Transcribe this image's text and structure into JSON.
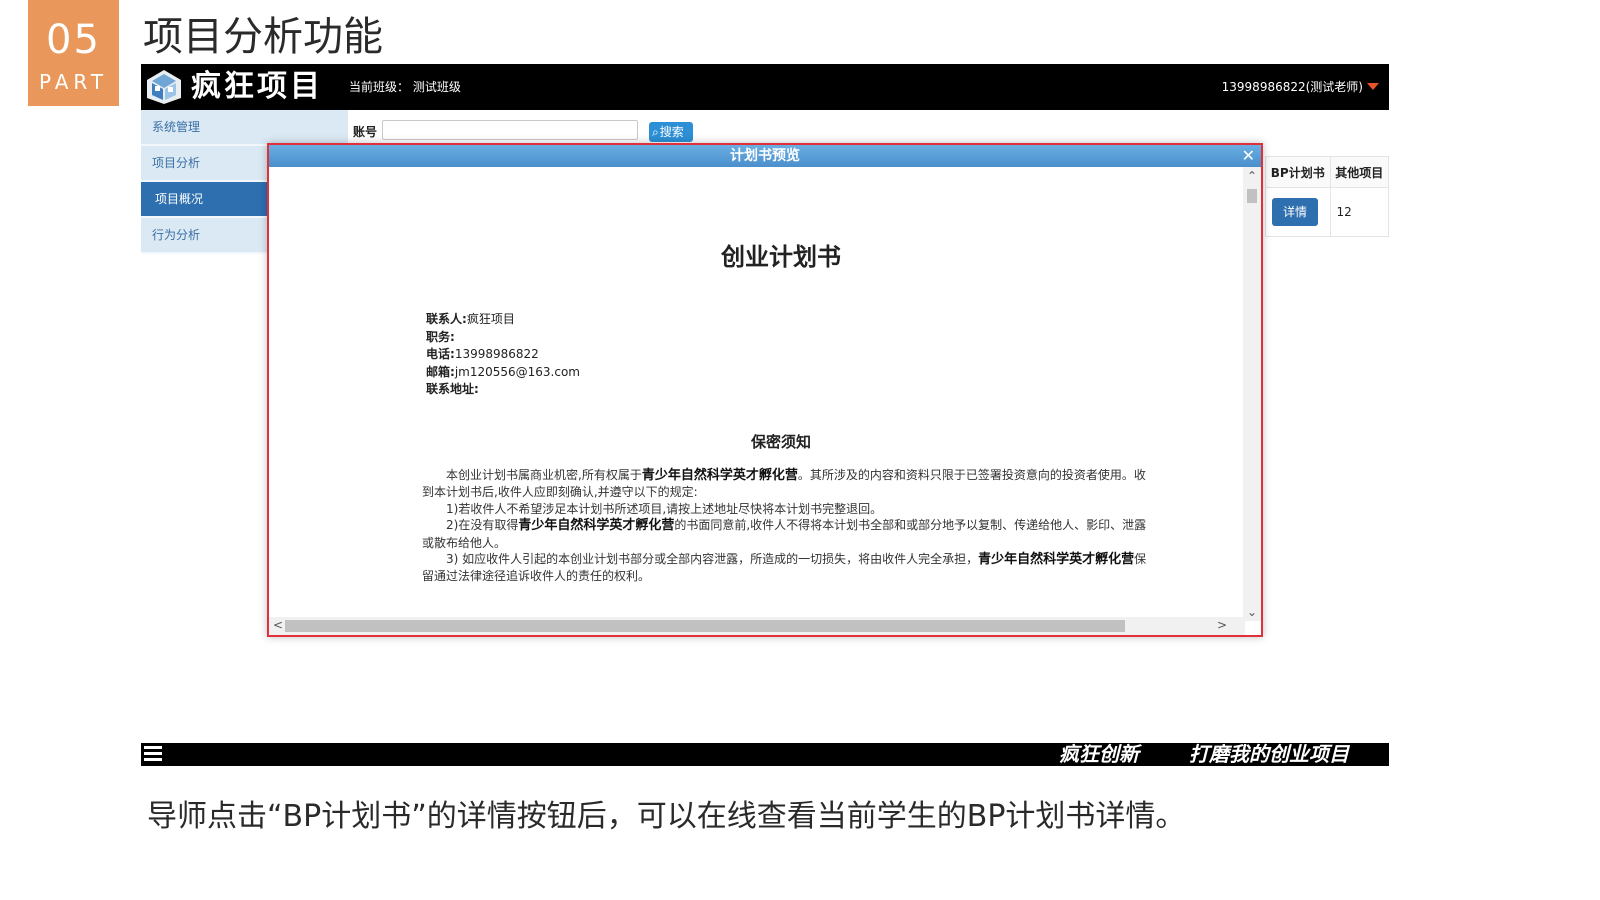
{
  "slide": {
    "part_number": "05",
    "part_word": "PART",
    "title": "项目分析功能",
    "caption": "导师点击“BP计划书”的详情按钮后，可以在线查看当前学生的BP计划书详情。",
    "slogan_left": "疯狂创新",
    "slogan_right": "打磨我的创业项目"
  },
  "app": {
    "logo_text": "疯狂项目",
    "class_info": "当前班级：  测试班级",
    "user_info": "13998986822(测试老师)",
    "sidebar": [
      {
        "label": "系统管理",
        "active": false
      },
      {
        "label": "项目分析",
        "active": false
      },
      {
        "label": "项目概况",
        "active": true
      },
      {
        "label": "行为分析",
        "active": false
      }
    ],
    "search": {
      "label": "账号",
      "value": "",
      "button": "搜索"
    },
    "table": {
      "headers": [
        "BP计划书",
        "其他项目"
      ],
      "row": {
        "button": "详情",
        "other": "12"
      }
    }
  },
  "modal": {
    "title": "计划书预览",
    "close": "✕",
    "doc_title": "创业计划书",
    "contact": [
      {
        "label": "联系人:",
        "value": "疯狂项目"
      },
      {
        "label": "职务:",
        "value": ""
      },
      {
        "label": "电话:",
        "value": "13998986822"
      },
      {
        "label": "邮箱:",
        "value": "jm120556@163.com"
      },
      {
        "label": "联系地址:",
        "value": ""
      }
    ],
    "confidentiality_title": "保密须知",
    "org_name": "青少年自然科学英才孵化营",
    "p1_a": "本创业计划书属商业机密,所有权属于",
    "p1_b": "。其所涉及的内容和资料只限于已签署投资意向的投资者使用。收到本计划书后,收件人应即刻确认,并遵守以下的规定:",
    "p2": "1)若收件人不希望涉足本计划书所述项目,请按上述地址尽快将本计划书完整退回。",
    "p3_a": "2)在没有取得",
    "p3_b": "的书面同意前,收件人不得将本计划书全部和或部分地予以复制、传递给他人、影印、泄露或散布给他人。",
    "p4_a": "3) 如应收件人引起的本创业计划书部分或全部内容泄露，所造成的一切损失，将由收件人完全承担，",
    "p4_b": "保留通过法律途径追诉收件人的责任的权利。"
  }
}
